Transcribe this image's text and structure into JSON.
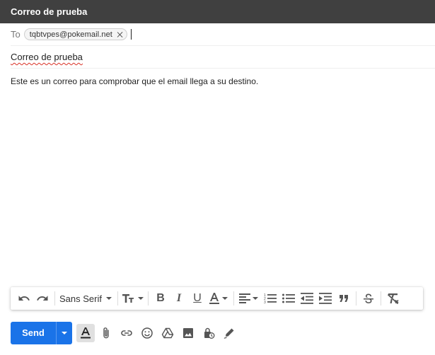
{
  "window": {
    "title": "Correo de prueba"
  },
  "to": {
    "label": "To",
    "recipients": [
      "tqbtvpes@pokemail.net"
    ]
  },
  "subject": {
    "value": "Correo de prueba"
  },
  "body": {
    "text": "Este es un correo para comprobar que el email llega a su destino."
  },
  "format_toolbar": {
    "font_family": "Sans Serif",
    "buttons": [
      "undo-icon",
      "redo-icon",
      "font-size-icon",
      "bold-icon",
      "italic-icon",
      "underline-icon",
      "text-color-icon",
      "align-icon",
      "numbered-list-icon",
      "bulleted-list-icon",
      "indent-less-icon",
      "indent-more-icon",
      "quote-icon",
      "strikethrough-icon",
      "remove-formatting-icon"
    ]
  },
  "actions": {
    "send_label": "Send",
    "icons": [
      "formatting-options-icon",
      "attach-icon",
      "link-icon",
      "emoji-icon",
      "drive-icon",
      "photo-icon",
      "confidential-mode-icon",
      "signature-icon"
    ]
  },
  "colors": {
    "titlebar": "#404040",
    "send": "#1a73e8",
    "spellcheck": "#d93025"
  }
}
